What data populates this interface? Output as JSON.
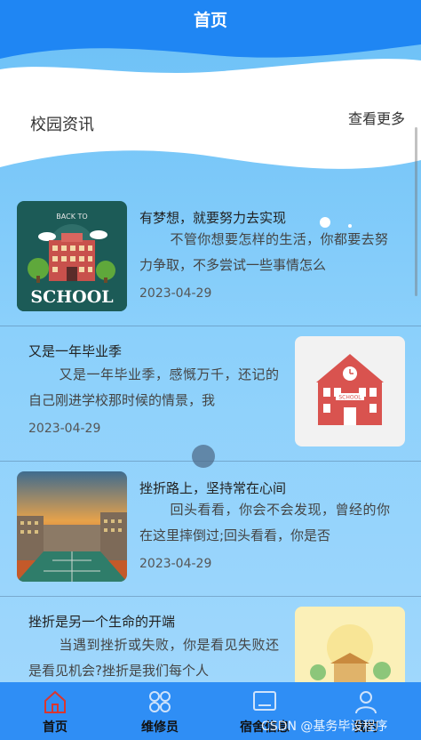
{
  "header": {
    "title": "首页"
  },
  "section": {
    "title": "校园资讯",
    "more_label": "查看更多"
  },
  "news": [
    {
      "title": "有梦想，就要努力去实现",
      "body": "不管你想要怎样的生活，你都要去努力争取，不多尝试一些事情怎么",
      "date": "2023-04-29",
      "image_icon": "back-to-school-illustration",
      "image_text": [
        "BACK TO",
        "SCHOOL"
      ]
    },
    {
      "title": "又是一年毕业季",
      "body": "又是一年毕业季，感慨万千，还记的自己刚进学校那时候的情景，我",
      "date": "2023-04-29",
      "image_icon": "school-building-icon",
      "image_text": [
        "SCHOOL"
      ]
    },
    {
      "title": "挫折路上，坚持常在心间",
      "body": "回头看看，你会不会发现，曾经的你在这里摔倒过;回头看看，你是否",
      "date": "2023-04-29",
      "image_icon": "campus-sunset-photo"
    },
    {
      "title": "挫折是另一个生命的开端",
      "body": "当遇到挫折或失败，你是看见失败还是看见机会?挫折是我们每个人",
      "image_icon": "campus-illustration"
    }
  ],
  "tabs": [
    {
      "label": "首页",
      "icon": "home-icon",
      "active": true
    },
    {
      "label": "维修员",
      "icon": "grid-icon",
      "active": false
    },
    {
      "label": "宿舍信息",
      "icon": "dorm-info-icon",
      "active": false
    },
    {
      "label": "我的",
      "icon": "user-icon",
      "active": false
    }
  ],
  "watermark": "CSDN @基务毕设程序",
  "colors": {
    "header": "#1f86f3",
    "tabbar": "#2f8ef5",
    "content_bg": "#8bd0fb"
  }
}
